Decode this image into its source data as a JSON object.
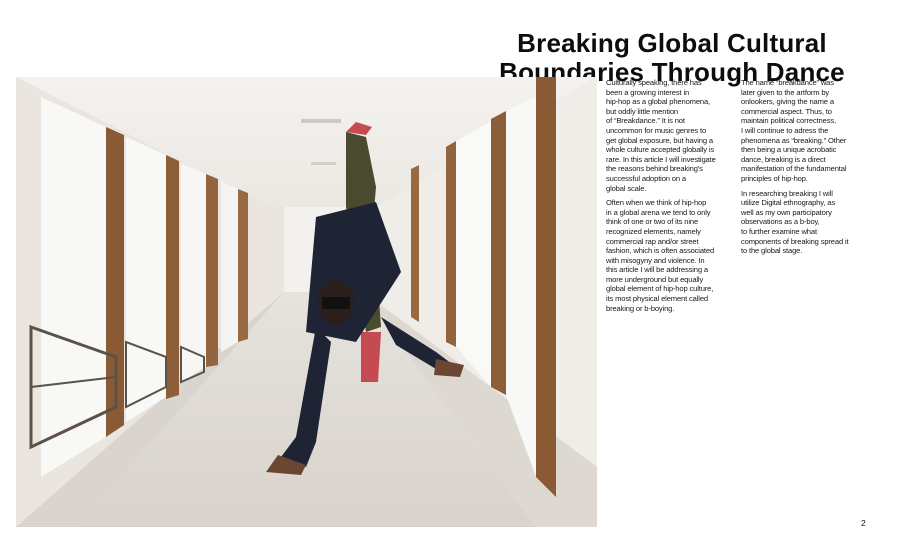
{
  "title": {
    "line1": "Breaking Global Cultural",
    "line2": "Boundaries Through Dance"
  },
  "photo": {
    "subject": "dancer-in-hallway"
  },
  "column1": {
    "p1": "Culturally speaking, there has\nbeen a growing interest in\nhip-hop as a global phenomena,\nbut oddly little mention\nof “Breakdance.” It is not\nuncommon for music genres to\nget global exposure, but having a\nwhole culture accepted globally is\nrare. In this article I will investigate\nthe reasons behind breaking's\nsuccessful adoption on a\nglobal scale.",
    "p2": "Often when we think of hip-hop\nin a global arena we tend to only\nthink of one or two of its nine\nrecognized elements, namely\ncommercial rap and/or street\nfashion, which is often associated\nwith misogyny and violence. In\nthis article I will be addressing a\nmore underground but equally\nglobal element of hip-hop culture,\nits most physical element called\nbreaking or b-boying."
  },
  "column2": {
    "p1": "The name “breakdance” was\nlater given to the artform by\nonlookers, giving the name a\ncommercial aspect. Thus, to\nmaintain political correctness,\nI will continue to adress the\nphenomena as “breaking.” Other\nthen being a unique acrobatic\ndance, breaking is a direct\nmanifestation of the fundamental\nprinciples of hip-hop.",
    "p2": "In researching breaking I will\nutilize  Digital ethnography, as\nwell as my own participatory\nobservations as a b-boy,\nto further examine what\ncomponents of breaking spread it\nto the global stage."
  },
  "page_number": "2"
}
